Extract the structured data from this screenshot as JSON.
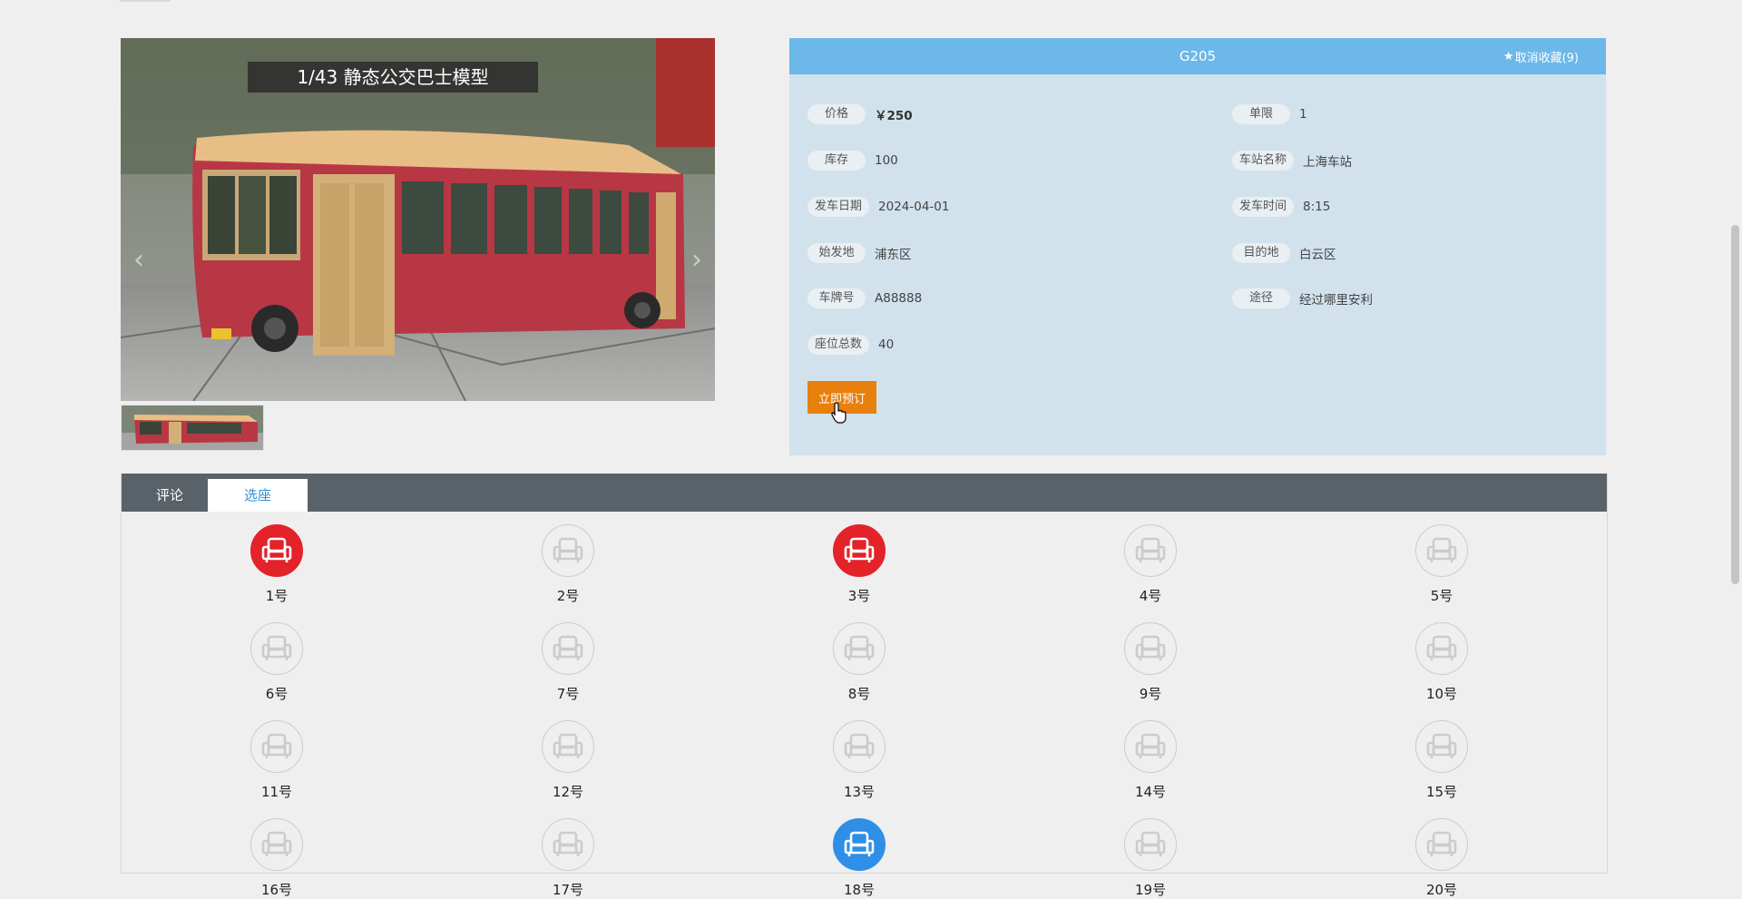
{
  "gallery": {
    "banner_text": "1/43 静态公交巴士模型",
    "prev_icon": "chevron-left-icon",
    "next_icon": "chevron-right-icon"
  },
  "detail": {
    "title": "G205",
    "favorite_label": "取消收藏(9)",
    "favorite_icon": "star-icon",
    "fields": [
      {
        "label": "价格",
        "value": "￥250"
      },
      {
        "label": "单限",
        "value": "1"
      },
      {
        "label": "库存",
        "value": "100"
      },
      {
        "label": "车站名称",
        "value": "上海车站"
      },
      {
        "label": "发车日期",
        "value": "2024-04-01"
      },
      {
        "label": "发车时间",
        "value": "8:15"
      },
      {
        "label": "始发地",
        "value": "浦东区"
      },
      {
        "label": "目的地",
        "value": "白云区"
      },
      {
        "label": "车牌号",
        "value": "A88888"
      },
      {
        "label": "途径",
        "value": "经过哪里安利"
      },
      {
        "label": "座位总数",
        "value": "40"
      }
    ],
    "book_label": "立即预订"
  },
  "tabs": [
    {
      "label": "评论",
      "active": false
    },
    {
      "label": "选座",
      "active": true
    }
  ],
  "seat_icon": "armchair-icon",
  "seats": [
    {
      "label": "1号",
      "status": "sold"
    },
    {
      "label": "2号",
      "status": "available"
    },
    {
      "label": "3号",
      "status": "sold"
    },
    {
      "label": "4号",
      "status": "available"
    },
    {
      "label": "5号",
      "status": "available"
    },
    {
      "label": "6号",
      "status": "available"
    },
    {
      "label": "7号",
      "status": "available"
    },
    {
      "label": "8号",
      "status": "available"
    },
    {
      "label": "9号",
      "status": "available"
    },
    {
      "label": "10号",
      "status": "available"
    },
    {
      "label": "11号",
      "status": "available"
    },
    {
      "label": "12号",
      "status": "available"
    },
    {
      "label": "13号",
      "status": "available"
    },
    {
      "label": "14号",
      "status": "available"
    },
    {
      "label": "15号",
      "status": "available"
    },
    {
      "label": "16号",
      "status": "available"
    },
    {
      "label": "17号",
      "status": "available"
    },
    {
      "label": "18号",
      "status": "selected"
    },
    {
      "label": "19号",
      "status": "available"
    },
    {
      "label": "20号",
      "status": "available"
    }
  ],
  "colors": {
    "header_blue": "#6cb8e8",
    "panel_blue": "#d1e2ec",
    "book_orange": "#e8800d",
    "sold_red": "#e3222a",
    "selected_blue": "#2f8fe6",
    "tabbar_gray": "#596268"
  }
}
